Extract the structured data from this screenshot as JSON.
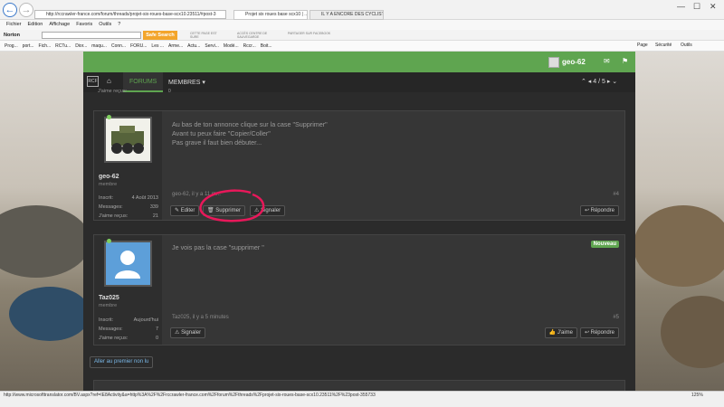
{
  "browser": {
    "url": "http://rccrawler-france.com/forum/threads/projet-six-roues-base-scx10.23511/#post-3",
    "tabs": [
      "Projet six roues base scx10 | ...",
      "IL Y A ENCORE DES CYCLISTES..."
    ],
    "menu": [
      "Fichier",
      "Edition",
      "Affichage",
      "Favoris",
      "Outils",
      "?"
    ],
    "norton": {
      "brand": "Norton",
      "safe_search": "Safe Search",
      "tools": [
        "CETTE PAGE EST SURE",
        "ACCÈS CENTRE DE SAUVEGARDE",
        "PARTAGER SUR FACEBOOK"
      ]
    },
    "favorites": [
      "Prog...",
      "port...",
      "Fich...",
      "RCTu...",
      "Dior...",
      "maqu...",
      "Conn...",
      "FORU...",
      "Les ...",
      "Arme...",
      "Actu...",
      "Servi...",
      "Modé...",
      "Rccr...",
      "Boit..."
    ],
    "right_tools": [
      "Page",
      "Sécurité",
      "Outils"
    ],
    "status_url": "http://www.microsofttranslator.com/BV.aspx?ref=IE8Activity&a=http%3A%2F%2Frccrawler-france.com%2Fforum%2Fthreads%2Fprojet-six-roues-base-scx10.23511%2F%23post-355733",
    "zoom": "125%"
  },
  "forum": {
    "user": "geo-62",
    "nav": {
      "forums": "FORUMS",
      "membres": "MEMBRES",
      "pagination": "4 / 5"
    },
    "top_snippet": "J'aime reçus:",
    "top_snippet_value": "0",
    "posts": [
      {
        "username": "geo-62",
        "role": "membre",
        "stats": [
          {
            "k": "Inscrit:",
            "v": "4 Août 2013"
          },
          {
            "k": "Messages:",
            "v": "339"
          },
          {
            "k": "J'aime reçus:",
            "v": "21"
          }
        ],
        "lines": [
          "Au bas de ton annonce clique sur la case \"Supprimer\"",
          "Avant tu peux faire \"Copier/Coller\"",
          "Pas grave il faut bien débuter..."
        ],
        "meta": "geo-62, il y a 11 m...",
        "num": "#4",
        "actions": [
          "Editer",
          "Supprimer",
          "Signaler"
        ],
        "reply": "Répondre"
      },
      {
        "username": "Taz025",
        "role": "membre",
        "stats": [
          {
            "k": "Inscrit:",
            "v": "Aujourd'hui"
          },
          {
            "k": "Messages:",
            "v": "7"
          },
          {
            "k": "J'aime reçus:",
            "v": "0"
          }
        ],
        "lines": [
          "Je vois pas la case \"supprimer \""
        ],
        "badge": "Nouveau",
        "meta": "Taz025, il y a 5 minutes",
        "num": "#5",
        "actions": [
          "Signaler"
        ],
        "like": "J'aime",
        "reply": "Répondre"
      }
    ],
    "first_unread": "Aller au premier non lu"
  }
}
